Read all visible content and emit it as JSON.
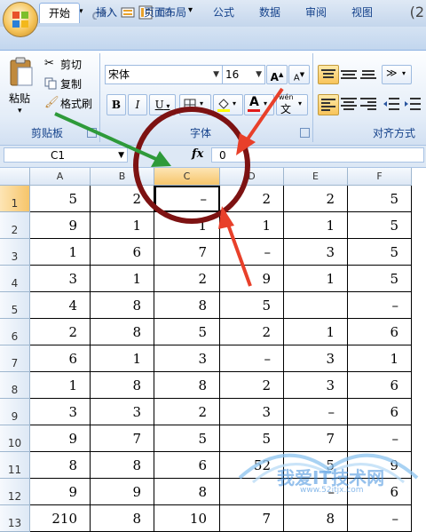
{
  "titlebar": {
    "title_fragment": "(2",
    "qat_dropdown_glyph": "▾"
  },
  "tabs": [
    "开始",
    "插入",
    "页面布局",
    "公式",
    "数据",
    "审阅",
    "视图"
  ],
  "clipboard": {
    "paste_label": "粘贴",
    "cut_label": "剪切",
    "copy_label": "复制",
    "format_painter_label": "格式刷",
    "group_label": "剪贴板"
  },
  "font": {
    "family_value": "宋体",
    "size_value": "16",
    "bold": "B",
    "italic": "I",
    "underline": "U",
    "font_color_glyph": "A",
    "grow_glyph": "A",
    "shrink_glyph": "A",
    "phonetic_glyph": "wén",
    "group_label": "字体"
  },
  "alignment": {
    "group_label": "对齐方式"
  },
  "formula_bar": {
    "name_box": "C1",
    "fx_label": "fx",
    "content": "0"
  },
  "sheet": {
    "columns": [
      "A",
      "B",
      "C",
      "D",
      "E",
      "F"
    ],
    "selected_column": "C",
    "rows": [
      {
        "n": "1",
        "cells": [
          "5",
          "2",
          "–",
          "2",
          "2",
          "5"
        ]
      },
      {
        "n": "2",
        "cells": [
          "9",
          "1",
          "1",
          "1",
          "1",
          "5"
        ]
      },
      {
        "n": "3",
        "cells": [
          "1",
          "6",
          "7",
          "–",
          "3",
          "5"
        ]
      },
      {
        "n": "4",
        "cells": [
          "3",
          "1",
          "2",
          "9",
          "1",
          "5"
        ]
      },
      {
        "n": "5",
        "cells": [
          "4",
          "8",
          "8",
          "5",
          "",
          "–"
        ]
      },
      {
        "n": "6",
        "cells": [
          "2",
          "8",
          "5",
          "2",
          "1",
          "6"
        ]
      },
      {
        "n": "7",
        "cells": [
          "6",
          "1",
          "3",
          "–",
          "3",
          "1"
        ]
      },
      {
        "n": "8",
        "cells": [
          "1",
          "8",
          "8",
          "2",
          "3",
          "6"
        ]
      },
      {
        "n": "9",
        "cells": [
          "3",
          "3",
          "2",
          "3",
          "–",
          "6"
        ]
      },
      {
        "n": "10",
        "cells": [
          "9",
          "7",
          "5",
          "5",
          "7",
          "–"
        ]
      },
      {
        "n": "11",
        "cells": [
          "8",
          "8",
          "6",
          "52",
          "5",
          "9"
        ]
      },
      {
        "n": "12",
        "cells": [
          "9",
          "9",
          "8",
          "",
          "–",
          "6"
        ]
      },
      {
        "n": "13",
        "cells": [
          "210",
          "8",
          "10",
          "7",
          "8",
          "–"
        ]
      }
    ]
  },
  "watermark": {
    "text": "我爱IT技术网",
    "url_text": "www.52itjx.com"
  },
  "colors": {
    "circle": "#7d1212",
    "arrow_red": "#e8402a",
    "arrow_green": "#2e9a3a",
    "ribbon_text": "#15428b"
  }
}
